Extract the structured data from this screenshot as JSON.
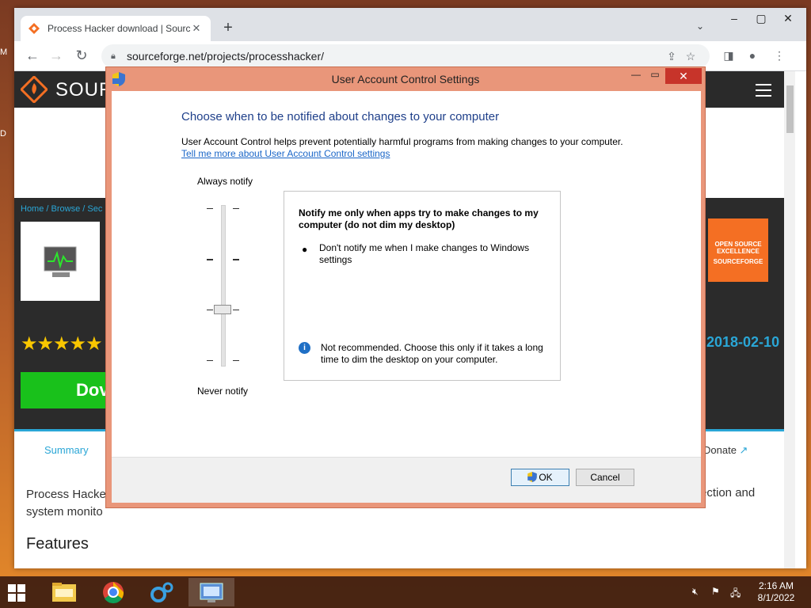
{
  "desktop": {
    "label_top": "M",
    "label_mid": "D"
  },
  "browser": {
    "tab_title": "Process Hacker download | Sourc",
    "url": "sourceforge.net/projects/processhacker/"
  },
  "page": {
    "logo_text": "SOUR",
    "breadcrumb": "Home / Browse / Sec",
    "stars": "★★★★★",
    "download_label": "Dov",
    "badge_text": "OPEN SOURCE EXCELLENCE",
    "badge_brand": "SOURCEFORGE",
    "date": "2018-02-10",
    "tab_summary": "Summary",
    "tab_donate": "Donate",
    "desc_left": "Process Hacke",
    "desc_right": "ection and",
    "desc_line2": "system monito",
    "features": "Features"
  },
  "uac": {
    "title": "User Account Control Settings",
    "heading": "Choose when to be notified about changes to your computer",
    "description": "User Account Control helps prevent potentially harmful programs from making changes to your computer.",
    "link": "Tell me more about User Account Control settings",
    "always": "Always notify",
    "never": "Never notify",
    "slider_level": 3,
    "slider_levels": 4,
    "info_title": "Notify me only when apps try to make changes to my computer (do not dim my desktop)",
    "info_point": "Don't notify me when I make changes to Windows settings",
    "info_note": "Not recommended. Choose this only if it takes a long time to dim the desktop on your computer.",
    "ok": "OK",
    "cancel": "Cancel"
  },
  "taskbar": {
    "time": "2:16 AM",
    "date": "8/1/2022"
  },
  "colors": {
    "accent": "#e9967a",
    "close": "#c7342a",
    "link": "#1a66c8",
    "heading": "#1e3f8a"
  }
}
